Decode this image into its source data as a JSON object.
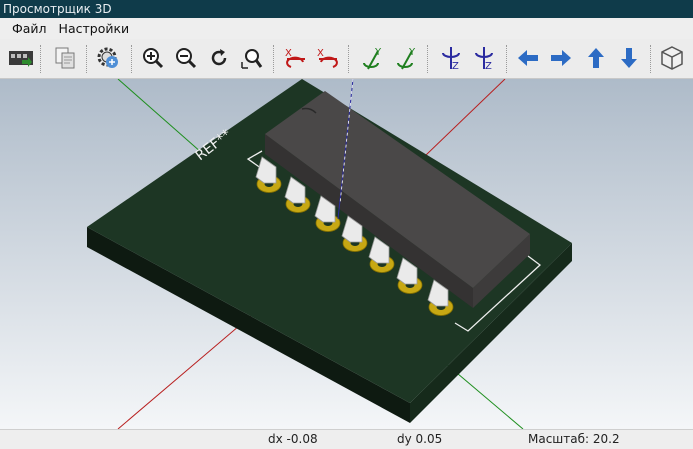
{
  "window": {
    "title": "Просмотрщик 3D"
  },
  "menu": {
    "items": [
      "Файл",
      "Настройки"
    ]
  },
  "toolbar": {
    "buttons": [
      "reload-board-icon",
      "copy-to-clipboard-icon",
      "settings-icon",
      "zoom-in-icon",
      "zoom-out-icon",
      "redraw-icon",
      "zoom-fit-icon",
      "rotate-x-cw-icon",
      "rotate-x-ccw-icon",
      "rotate-y-cw-icon",
      "rotate-y-ccw-icon",
      "rotate-z-cw-icon",
      "rotate-z-ccw-icon",
      "move-left-icon",
      "move-right-icon",
      "move-up-icon",
      "move-down-icon",
      "ortho-view-icon"
    ],
    "axis_labels": {
      "x": "X",
      "y": "Y",
      "z": "Z"
    }
  },
  "scene": {
    "silkscreen_ref": "REF**",
    "colors": {
      "background_top": "#aebbc9",
      "background_bottom": "#f4f6f8",
      "board": "#1d3624",
      "pads": "#c7a813",
      "ic_body": "#4a4848",
      "x_axis": "#cc1f1f",
      "y_axis": "#1f8f1f",
      "z_axis": "#2a2aa0"
    }
  },
  "status": {
    "dx": "dx -0.08",
    "dy": "dy 0.05",
    "zoom": "Масштаб: 20.2"
  }
}
